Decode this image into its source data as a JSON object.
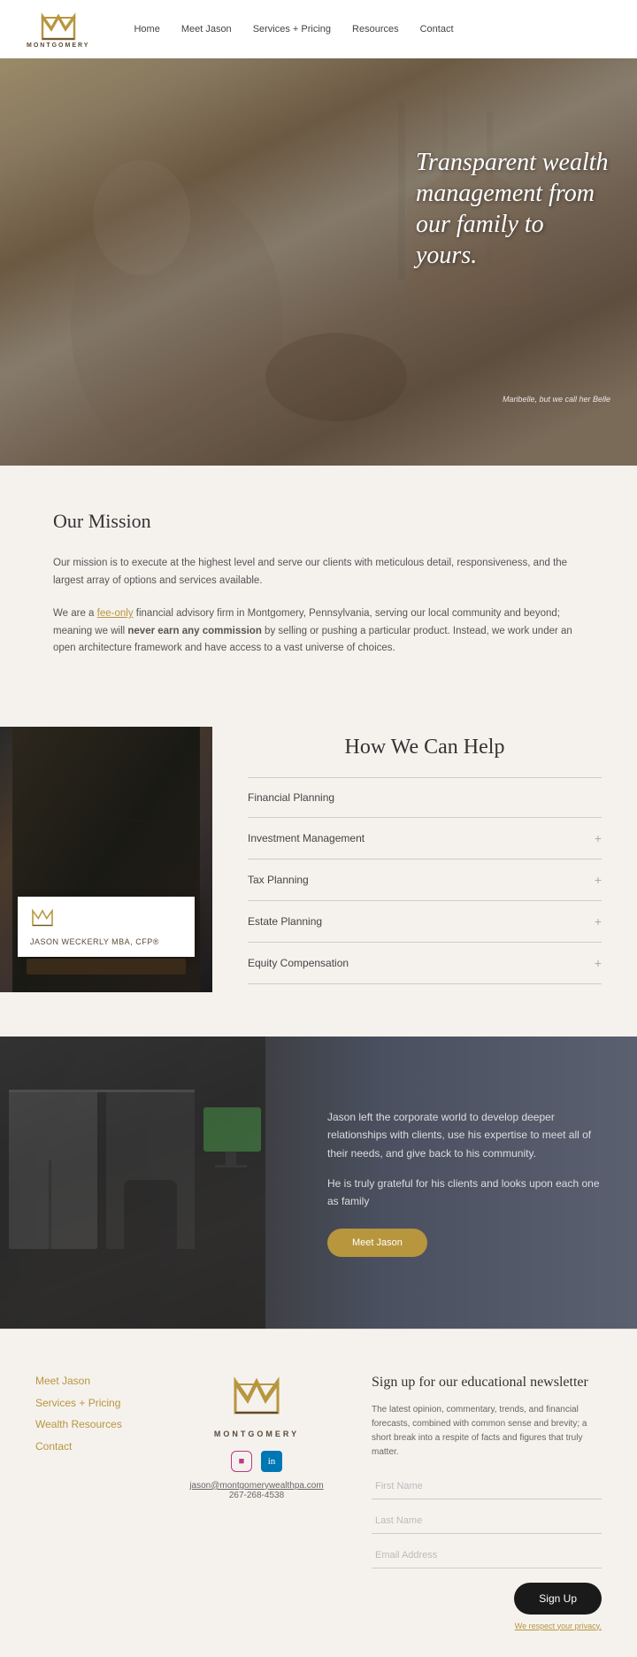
{
  "nav": {
    "logo_text": "MONTGOMERY",
    "links": [
      "Home",
      "Meet Jason",
      "Services + Pricing",
      "Resources",
      "Contact"
    ]
  },
  "hero": {
    "headline": "Transparent wealth management from our family to yours.",
    "caption": "Maribelle, but we call her Belle"
  },
  "mission": {
    "heading": "Our Mission",
    "para1": "Our mission is to execute at the highest level and serve our clients with meticulous detail, responsiveness, and the largest array of options and services available.",
    "para2_prefix": "We are a ",
    "para2_link": "fee-only",
    "para2_mid": " financial advisory firm in Montgomery, Pennsylvania, serving our local community and beyond; meaning we will ",
    "para2_bold": "never earn any commission",
    "para2_suffix": " by selling or pushing a particular product. Instead, we work under an open architecture framework and have access to a vast universe of choices."
  },
  "help": {
    "heading": "How We Can Help",
    "items": [
      {
        "label": "Financial Planning",
        "has_plus": false
      },
      {
        "label": "Investment Management",
        "has_plus": true
      },
      {
        "label": "Tax Planning",
        "has_plus": true
      },
      {
        "label": "Estate Planning",
        "has_plus": true
      },
      {
        "label": "Equity Compensation",
        "has_plus": true
      }
    ],
    "card_name": "JASON WECKERLY MBA, CFP®"
  },
  "jason": {
    "para1": "Jason left the corporate world to develop deeper relationships with clients, use his expertise to meet all of their needs, and give back to his community.",
    "para2": "He is truly grateful for his clients and looks upon each one as family",
    "btn": "Meet Jason"
  },
  "footer": {
    "links": [
      "Meet Jason",
      "Services + Pricing",
      "Wealth Resources",
      "Contact"
    ],
    "logo_text": "MONTGOMERY",
    "email": "jason@montgomerywealthpa.com",
    "phone": "267-268-4538",
    "newsletter": {
      "heading": "Sign up for our educational newsletter",
      "body": "The latest opinion, commentary, trends, and financial forecasts, combined with common sense and brevity; a short break into a respite of facts and figures that truly matter.",
      "field_first": "First Name",
      "field_last": "Last Name",
      "field_email": "Email Address",
      "btn_label": "Sign Up",
      "privacy": "We respect your privacy."
    }
  }
}
